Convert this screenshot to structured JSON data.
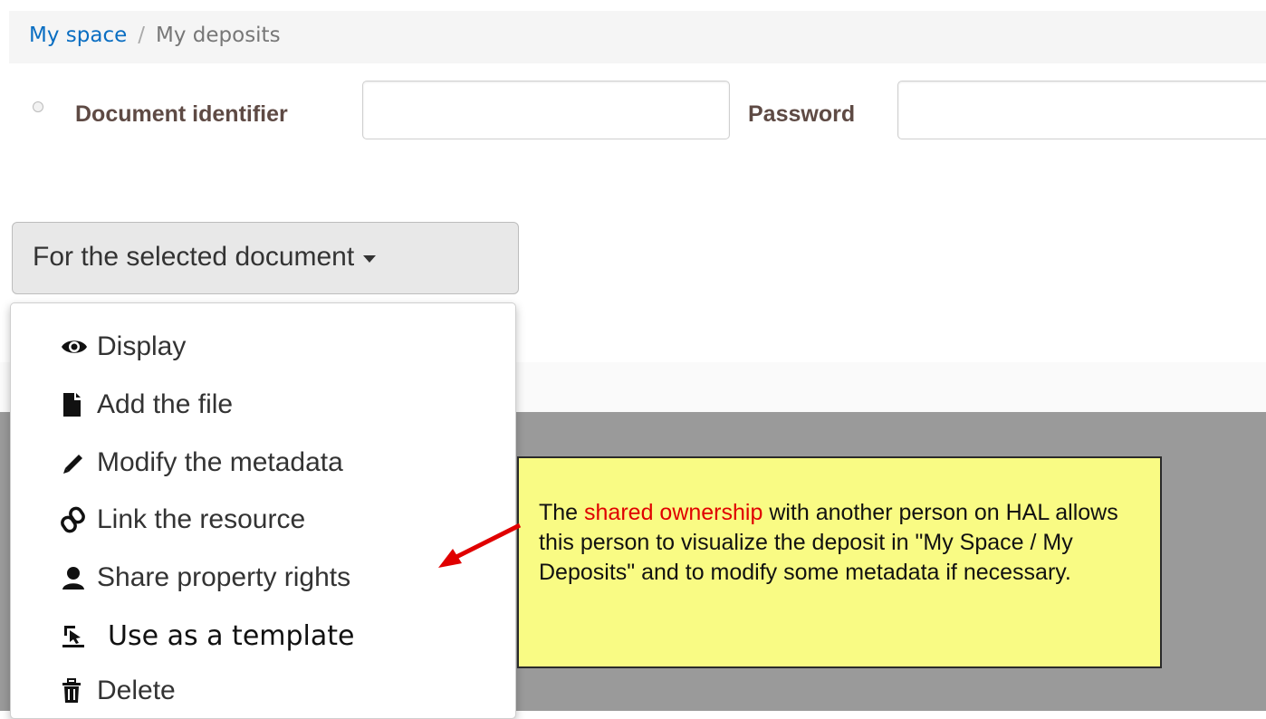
{
  "breadcrumb": {
    "root": "My space",
    "separator": "/",
    "current": "My deposits"
  },
  "form": {
    "id_label": "Document identifier",
    "id_value": "",
    "password_label": "Password",
    "password_value": ""
  },
  "dropdown": {
    "button_label": "For the selected document",
    "items": [
      {
        "label": "Display",
        "icon": "eye-icon"
      },
      {
        "label": "Add the file",
        "icon": "file-icon"
      },
      {
        "label": "Modify the metadata",
        "icon": "pencil-icon"
      },
      {
        "label": "Link the resource",
        "icon": "link-icon"
      },
      {
        "label": "Share property rights",
        "icon": "user-icon"
      },
      {
        "label": "Use as a template",
        "icon": "template-icon"
      },
      {
        "label": "Delete",
        "icon": "trash-icon"
      }
    ]
  },
  "callout": {
    "before": "The ",
    "highlight": "shared ownership",
    "after": " with another person on HAL allows this person to visualize the deposit in \"My Space / My Deposits\" and to modify some metadata if necessary."
  },
  "colors": {
    "link": "#0a6ec2",
    "callout_bg": "#f9fb84",
    "highlight": "#e00000",
    "arrow": "#e00000"
  }
}
